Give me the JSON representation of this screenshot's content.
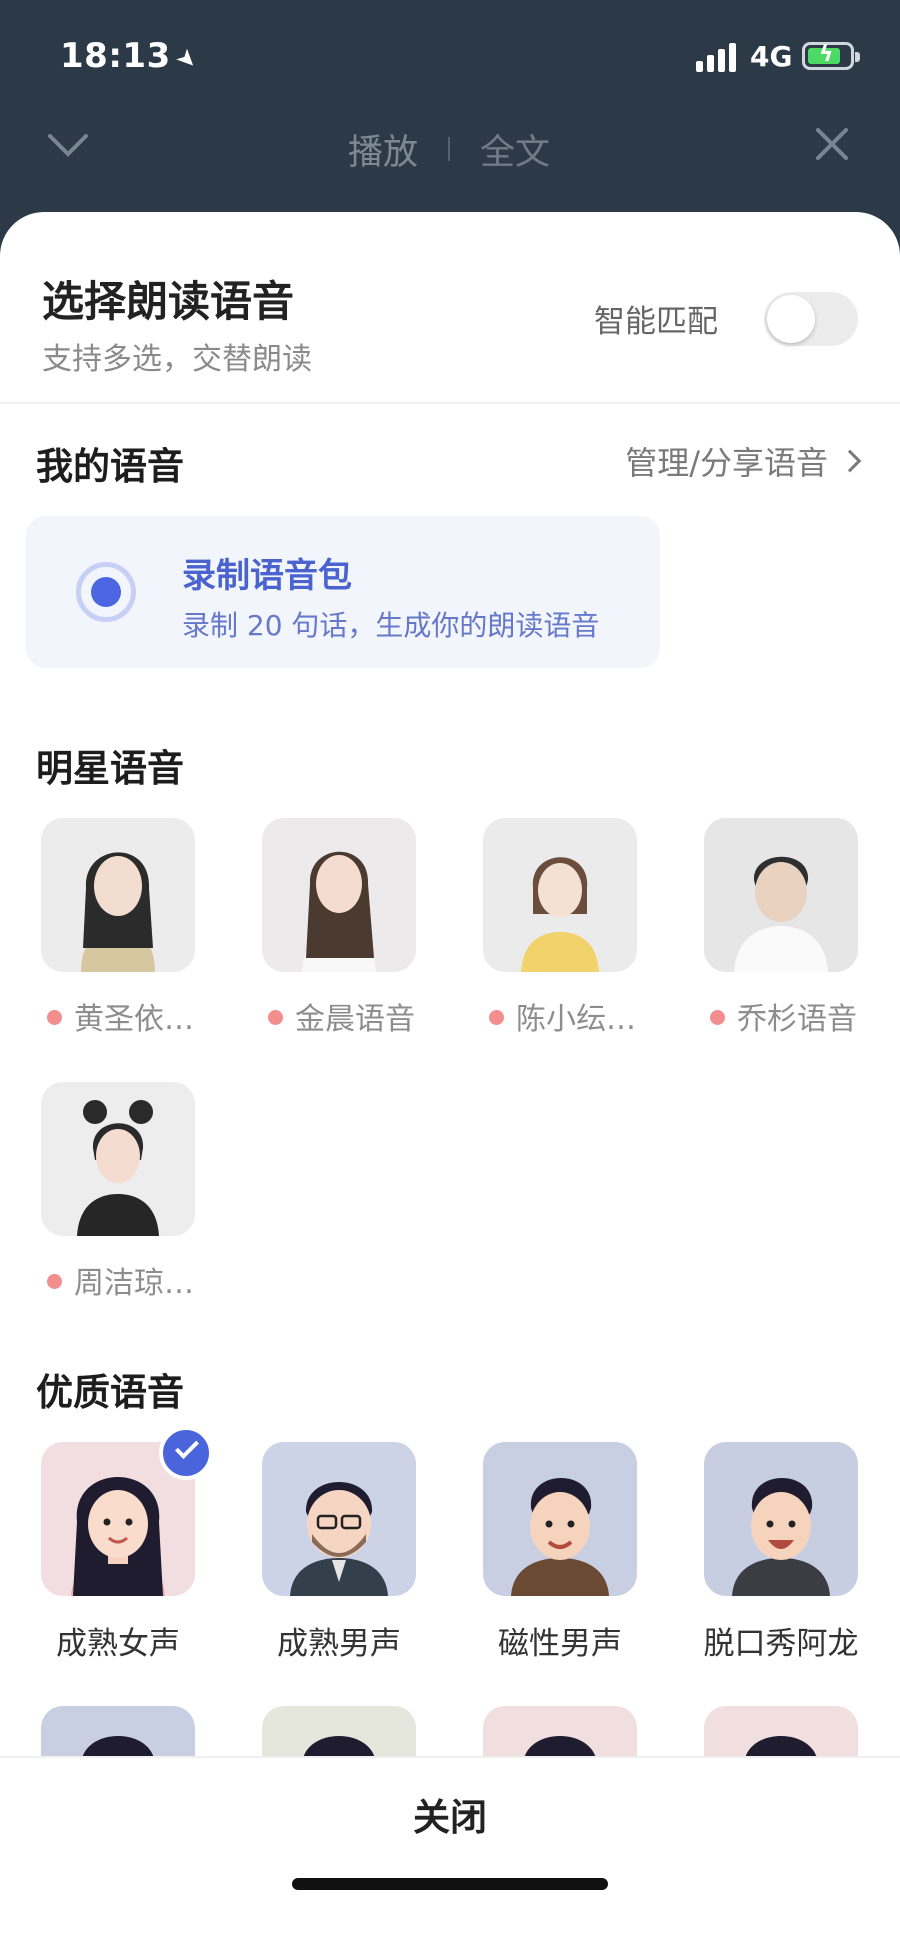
{
  "status_bar": {
    "time": "18:13",
    "network": "4G"
  },
  "header": {
    "tab_play": "播放",
    "tab_fulltext": "全文"
  },
  "sheet": {
    "title": "选择朗读语音",
    "subtitle": "支持多选，交替朗读",
    "smart_match_label": "智能匹配",
    "smart_match_on": false
  },
  "my_voice": {
    "title": "我的语音",
    "manage_label": "管理/分享语音",
    "record_title": "录制语音包",
    "record_desc": "录制 20 句话，生成你的朗读语音"
  },
  "celebrity": {
    "title": "明星语音",
    "items": [
      {
        "label": "黄圣依…"
      },
      {
        "label": "金晨语音"
      },
      {
        "label": "陈小纭…"
      },
      {
        "label": "乔杉语音"
      },
      {
        "label": "周洁琼…"
      }
    ]
  },
  "quality": {
    "title": "优质语音",
    "items": [
      {
        "label": "成熟女声",
        "selected": true
      },
      {
        "label": "成熟男声",
        "selected": false
      },
      {
        "label": "磁性男声",
        "selected": false
      },
      {
        "label": "脱口秀阿龙",
        "selected": false
      }
    ]
  },
  "footer": {
    "close_label": "关闭"
  },
  "colors": {
    "accent": "#4a65dc",
    "header_bg": "#2c3a48",
    "dot": "#f28e8e"
  }
}
